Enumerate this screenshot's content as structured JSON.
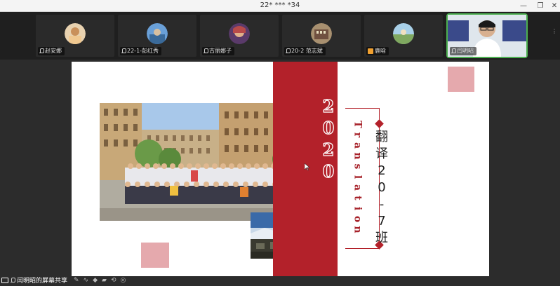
{
  "window": {
    "title": "22* *** *34",
    "minimize_glyph": "—",
    "maximize_glyph": "❐",
    "close_glyph": "✕"
  },
  "participants": [
    {
      "name": "赵安娜",
      "avatar_color": "#d9b07a"
    },
    {
      "name": "22-1-彭红秀",
      "avatar_color": "#4a80b8"
    },
    {
      "name": "古丽娜子",
      "avatar_color": "#6a4a7a"
    },
    {
      "name": "20-2 范志斌",
      "avatar_color": "#7a6a5a"
    },
    {
      "name": "鹿晗",
      "avatar_color": "#7fa860"
    },
    {
      "name": "闫明昭",
      "avatar_color": "#cfd8e0"
    }
  ],
  "slide": {
    "year_digits": [
      "2",
      "0",
      "2",
      "0"
    ],
    "english_letters": [
      "T",
      "r",
      "a",
      "n",
      "s",
      "l",
      "a",
      "t",
      "i",
      "o",
      "n"
    ],
    "class_chars": [
      "翻",
      "译",
      "2",
      "0",
      "-",
      "7",
      "班"
    ],
    "accent_color": "#b3212a",
    "square_color": "#e5a9ad"
  },
  "footer": {
    "share_text": "闫明昭的屏幕共享"
  }
}
